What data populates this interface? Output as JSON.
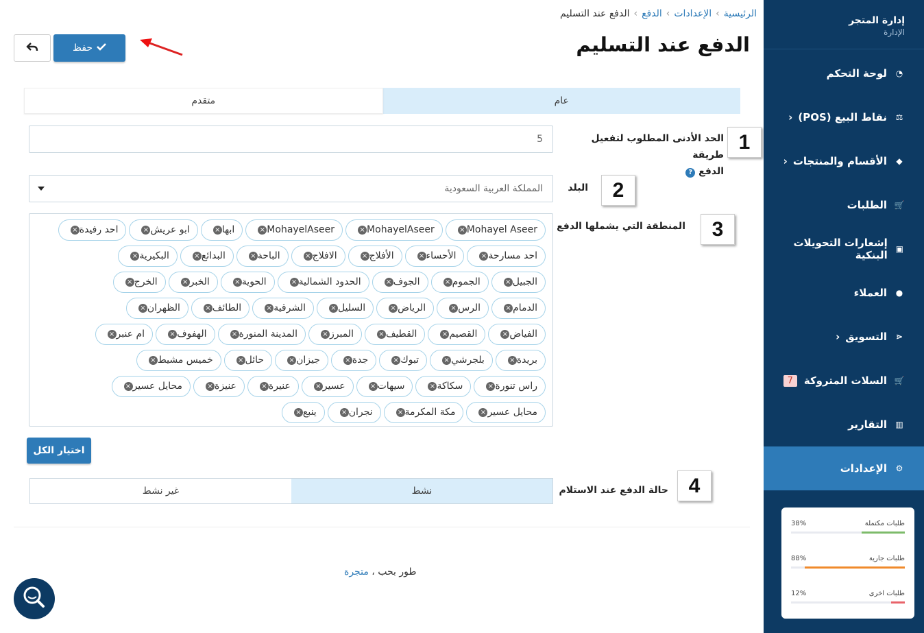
{
  "sidebar": {
    "store_title": "إدارة المتجر",
    "store_subtitle": "الإدارة",
    "items": [
      {
        "label": "لوحة التحكم",
        "icon": "dashboard-icon"
      },
      {
        "label": "نقاط البيع (POS)",
        "icon": "balance-icon",
        "chevron": "‹"
      },
      {
        "label": "الأقسام والمنتجات",
        "icon": "tag-icon",
        "chevron": "‹"
      },
      {
        "label": "الطلبات",
        "icon": "cart-icon"
      },
      {
        "label": "إشعارات التحويلات البنكية",
        "icon": "money-icon"
      },
      {
        "label": "العملاء",
        "icon": "user-icon"
      },
      {
        "label": "التسويق",
        "icon": "share-icon",
        "chevron": "‹"
      },
      {
        "label": "السلات المتروكة",
        "icon": "cart-icon",
        "badge": "7"
      },
      {
        "label": "التقارير",
        "icon": "chart-icon"
      },
      {
        "label": "الإعدادات",
        "icon": "gear-icon",
        "active": true
      }
    ],
    "stats": [
      {
        "label": "طلبات مكتملة",
        "percent": "38%",
        "value": 38,
        "color": "#7dbb6a"
      },
      {
        "label": "طلبات جارية",
        "percent": "88%",
        "value": 88,
        "color": "#f08a2c"
      },
      {
        "label": "طلبات اخرى",
        "percent": "12%",
        "value": 12,
        "color": "#e8636a"
      }
    ]
  },
  "breadcrumb": {
    "home": "الرئيسية",
    "settings": "الإعدادات",
    "payment": "الدفع",
    "current": "الدفع عند التسليم"
  },
  "page_title": "الدفع عند التسليم",
  "toolbar": {
    "save_label": "حفظ"
  },
  "tabs": {
    "general": "عام",
    "advanced": "متقدم"
  },
  "form": {
    "min_label_line1": "الحد الأدنى المطلوب لتفعيل طريقة",
    "min_label_line2": "الدفع",
    "min_value": "5",
    "country_label": "البلد",
    "country_value": "المملكة العربية السعودية",
    "region_label": "المنطقة التي يشملها الدفع",
    "regions": [
      [
        "Mohayel Aseer",
        "MohayelAseer",
        "MohayelAseer",
        "ابها",
        "ابو عريش",
        "احد رفيدة"
      ],
      [
        "احد مسارحة",
        "الأحساء",
        "الأفلاج",
        "الافلاج",
        "الباحة",
        "البدائع",
        "البكيرية"
      ],
      [
        "الجبيل",
        "الجموم",
        "الجوف",
        "الحدود الشمالية",
        "الحوية",
        "الخبر",
        "الخرج"
      ],
      [
        "الدمام",
        "الرس",
        "الرياض",
        "السليل",
        "الشرقية",
        "الطائف",
        "الظهران"
      ],
      [
        "الفياض",
        "القصيم",
        "القطيف",
        "المبرز",
        "المدينة المنورة",
        "الهفوف",
        "ام عنبر"
      ],
      [
        "بريدة",
        "بلجرشي",
        "تبوك",
        "جدة",
        "جيزان",
        "حائل",
        "خميس مشيط"
      ],
      [
        "راس تنورة",
        "سكاكة",
        "سيهات",
        "عسير",
        "عنيرة",
        "عنيزة",
        "محايل عسير"
      ],
      [
        "محايل عسير",
        "مكة المكرمة",
        "نجران",
        "ينبع"
      ]
    ],
    "select_all_label": "اختيار الكل",
    "status_label": "حالة الدفع عند الاستلام",
    "status_active": "نشط",
    "status_inactive": "غير نشط"
  },
  "annotations": [
    "1",
    "2",
    "3",
    "4"
  ],
  "footer": {
    "text": "طور بحب ،",
    "link": "متجرة"
  }
}
